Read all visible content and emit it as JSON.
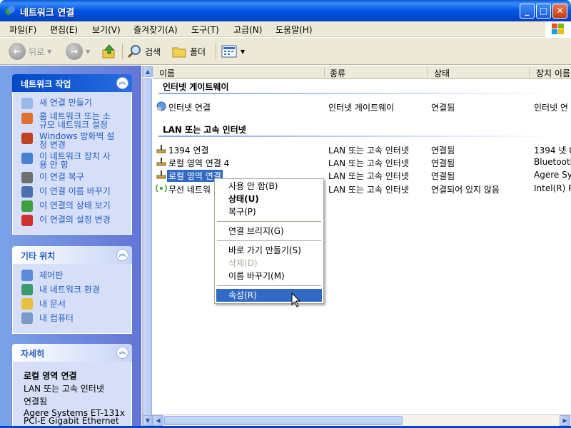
{
  "window": {
    "title": "네트워크 연결",
    "buttons": [
      "_",
      "□",
      "✕"
    ]
  },
  "menu": [
    "파일(F)",
    "편집(E)",
    "보기(V)",
    "즐겨찾기(A)",
    "도구(T)",
    "고급(N)",
    "도움말(H)"
  ],
  "toolbar": {
    "back": "뒤로",
    "forward": "",
    "up": "",
    "search": "검색",
    "folders": "폴더",
    "views": ""
  },
  "left": {
    "tasks": {
      "title": "네트워크 작업",
      "items": [
        "새 연결 만들기",
        "홈 네트워크 또는 소\n규모 네트워크 설정",
        "Windows 방화벽 설\n정 변경",
        "이 네트워크 장치 사\n용 안 함",
        "이 연결 복구",
        "이 연결 이름 바꾸기",
        "이 연결의 상태 보기",
        "이 연결의 설정 변경"
      ]
    },
    "other": {
      "title": "기타 위치",
      "items": [
        "제어판",
        "내 네트워크 환경",
        "내 문서",
        "내 컴퓨터"
      ]
    },
    "details": {
      "title": "자세히",
      "name": "로컬 영역 연결",
      "type": "LAN 또는 고속 인터넷",
      "status": "연결됨",
      "device": "Agere Systems ET-131x\nPCI-E Gigabit Ethernet"
    }
  },
  "columns": [
    "이름",
    "종류",
    "상태",
    "장치 이름"
  ],
  "groups": [
    {
      "title": "인터넷 게이트웨이",
      "rows": [
        {
          "name": "인터넷 연결",
          "type": "인터넷 게이트웨이",
          "status": "연결됨",
          "device": "인터넷 연"
        }
      ]
    },
    {
      "title": "LAN 또는 고속 인터넷",
      "rows": [
        {
          "name": "1394 연결",
          "type": "LAN 또는 고속 인터넷",
          "status": "연결됨",
          "device": "1394 넷 0"
        },
        {
          "name": "로컬 영역 연결 4",
          "type": "LAN 또는 고속 인터넷",
          "status": "연결됨",
          "device": "Bluetooth"
        },
        {
          "name": "로컬 영역 연결",
          "type": "LAN 또는 고속 인터넷",
          "status": "연결됨",
          "device": "Agere Sy"
        },
        {
          "name": "무선 네트워",
          "type": "LAN 또는 고속 인터넷",
          "status": "연결되어 있지 않음",
          "device": "Intel(R) P"
        }
      ]
    }
  ],
  "context_menu": [
    {
      "label": "사용 안 함(B)",
      "state": "normal"
    },
    {
      "label": "상태(U)",
      "state": "bold"
    },
    {
      "label": "복구(P)",
      "state": "normal"
    },
    {
      "label": "연결 브리지(G)",
      "state": "normal"
    },
    {
      "label": "바로 가기 만들기(S)",
      "state": "normal"
    },
    {
      "label": "삭제(D)",
      "state": "disabled"
    },
    {
      "label": "이름 바꾸기(M)",
      "state": "normal"
    },
    {
      "label": "속성(R)",
      "state": "highlighted"
    }
  ],
  "icons": {
    "back": "back-arrow-icon",
    "forward": "forward-arrow-icon",
    "up": "up-folder-icon",
    "search": "search-icon",
    "folders": "folders-icon",
    "views": "views-icon"
  }
}
